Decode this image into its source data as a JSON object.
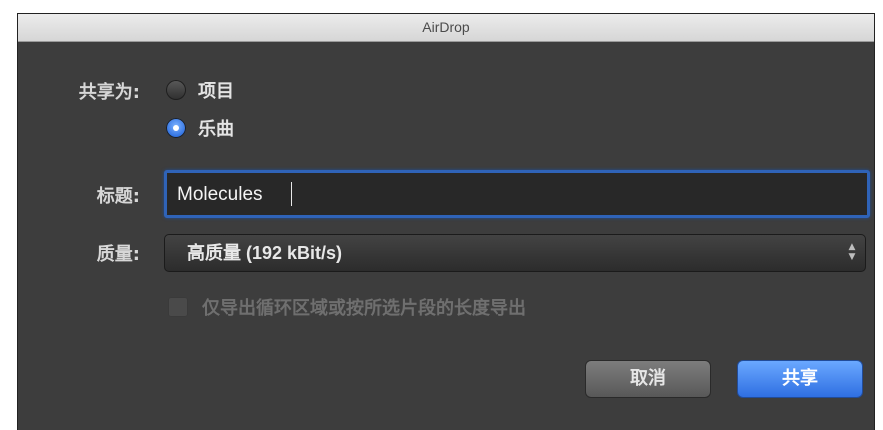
{
  "window": {
    "title": "AirDrop"
  },
  "share_as": {
    "label": "共享为:",
    "options": [
      {
        "label": "项目",
        "selected": false
      },
      {
        "label": "乐曲",
        "selected": true
      }
    ]
  },
  "title_field": {
    "label": "标题:",
    "value": "Molecules"
  },
  "quality": {
    "label": "质量:",
    "value": "高质量 (192 kBit/s)"
  },
  "cycle_option": {
    "label": "仅导出循环区域或按所选片段的长度导出",
    "checked": false,
    "enabled": false
  },
  "buttons": {
    "cancel": "取消",
    "share": "共享"
  },
  "colors": {
    "accent": "#2f6fe2",
    "window_bg": "#3d3d3d"
  }
}
